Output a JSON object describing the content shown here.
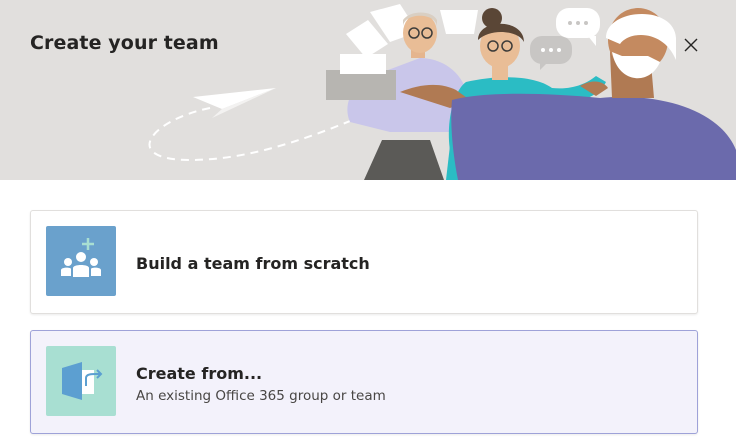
{
  "dialog": {
    "title": "Create your team"
  },
  "options": [
    {
      "title": "Build a team from scratch",
      "subtitle": "",
      "icon": "people-add-icon",
      "icon_bg": "#6aa1cc"
    },
    {
      "title": "Create from...",
      "subtitle": "An existing Office 365 group or team",
      "icon": "document-arrow-icon",
      "icon_bg": "#a8dfd2",
      "selected": true
    }
  ],
  "colors": {
    "header_bg": "#e1dfdd",
    "selected_card_bg": "#f3f2fb",
    "selected_card_border": "#9ea2d8",
    "figure_purple": "#6b6aac",
    "figure_teal": "#2bbcc4"
  }
}
